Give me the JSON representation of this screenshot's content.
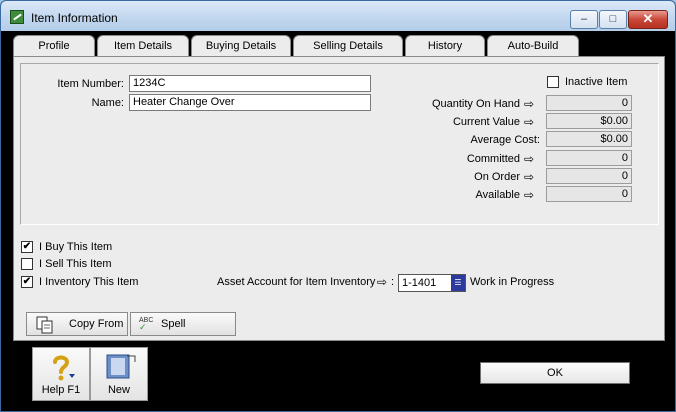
{
  "window": {
    "title": "Item Information",
    "minimize_glyph": "–",
    "maximize_glyph": "□",
    "close_glyph": "✕"
  },
  "tabs": [
    {
      "label": "Profile",
      "state": "active"
    },
    {
      "label": "Item Details",
      "state": "normal"
    },
    {
      "label": "Buying Details",
      "state": "normal"
    },
    {
      "label": "Selling Details",
      "state": "disabled"
    },
    {
      "label": "History",
      "state": "normal"
    },
    {
      "label": "Auto-Build",
      "state": "normal"
    }
  ],
  "profile": {
    "item_number_label": "Item Number:",
    "item_number_value": "1234C",
    "name_label": "Name:",
    "name_value": "Heater Change Over",
    "inactive_label": "Inactive Item",
    "inactive_checked": false,
    "stats": [
      {
        "label": "Quantity On Hand",
        "value": "0",
        "arrow": true
      },
      {
        "label": "Current Value",
        "value": "$0.00",
        "arrow": true
      },
      {
        "label": "Average Cost:",
        "value": "$0.00",
        "arrow": false
      },
      {
        "label": "Committed",
        "value": "0",
        "arrow": true
      },
      {
        "label": "On Order",
        "value": "0",
        "arrow": true
      },
      {
        "label": "Available",
        "value": "0",
        "arrow": true
      }
    ],
    "buy": {
      "label": "I Buy This Item",
      "checked": true
    },
    "sell": {
      "label": "I Sell This Item",
      "checked": false
    },
    "inventory": {
      "label": "I Inventory This Item",
      "checked": true
    },
    "asset_account_label": "Asset Account for Item Inventory",
    "asset_account_value": "1-1401",
    "asset_account_name": "Work in Progress",
    "copy_from_label": "Copy From",
    "spell_label": "Spell",
    "spell_icon_text": "ABC"
  },
  "footer": {
    "help_label": "Help F1",
    "new_label": "New",
    "ok_label": "OK"
  },
  "glyphs": {
    "arrow": "⇨",
    "check": "✔",
    "colon": ":"
  }
}
